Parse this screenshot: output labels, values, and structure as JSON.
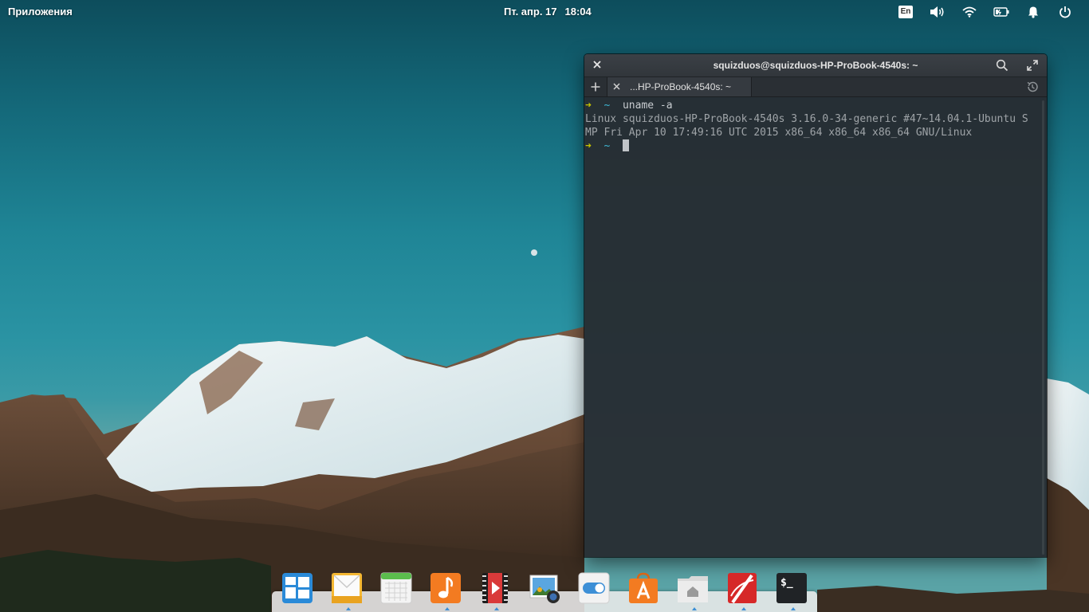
{
  "top_panel": {
    "apps_label": "Приложения",
    "date": "Пт. апр. 17",
    "time": "18:04",
    "keyboard_layout": "En",
    "indicator_icons": [
      "keyboard-layout-icon",
      "volume-icon",
      "wifi-icon",
      "battery-icon",
      "notifications-icon",
      "power-icon"
    ]
  },
  "terminal": {
    "title": "squizduos@squizduos-HP-ProBook-4540s: ~",
    "tab_label": "...HP-ProBook-4540s: ~",
    "lines": [
      {
        "arrow": "➜",
        "tilde": "~",
        "cmd": "uname -a"
      },
      {
        "text": "Linux squizduos-HP-ProBook-4540s 3.16.0-34-generic #47~14.04.1-Ubuntu S"
      },
      {
        "text": "MP Fri Apr 10 17:49:16 UTC 2015 x86_64 x86_64 x86_64 GNU/Linux"
      },
      {
        "arrow": "➜",
        "tilde": "~",
        "cmd": ""
      }
    ],
    "colors": {
      "arrow": "#c7c400",
      "tilde": "#3fb8d4",
      "output": "#9fa4a8"
    }
  },
  "dock": {
    "items": [
      {
        "name": "multitasking-view-icon",
        "running": false
      },
      {
        "name": "mail-icon",
        "running": true
      },
      {
        "name": "calendar-icon",
        "running": false
      },
      {
        "name": "music-icon",
        "running": true
      },
      {
        "name": "videos-icon",
        "running": true
      },
      {
        "name": "photos-icon",
        "running": false
      },
      {
        "name": "system-settings-icon",
        "running": false
      },
      {
        "name": "app-center-icon",
        "running": false
      },
      {
        "name": "files-icon",
        "running": true
      },
      {
        "name": "document-viewer-icon",
        "running": true
      },
      {
        "name": "terminal-icon",
        "running": true
      }
    ],
    "accent_color": "#3d8fd6"
  }
}
